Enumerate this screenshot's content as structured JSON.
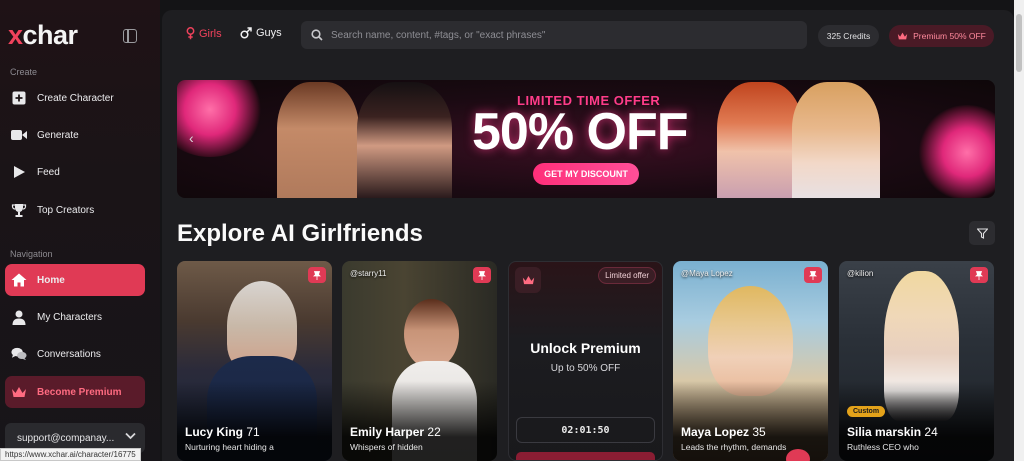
{
  "app": {
    "logo_x": "x",
    "logo_rest": "char"
  },
  "sidebar": {
    "create_label": "Create",
    "create_items": [
      {
        "label": "Create Character",
        "icon": "plus-square-icon"
      },
      {
        "label": "Generate",
        "icon": "video-camera-icon"
      },
      {
        "label": "Feed",
        "icon": "play-icon"
      },
      {
        "label": "Top Creators",
        "icon": "trophy-icon"
      }
    ],
    "navigation_label": "Navigation",
    "nav_items": [
      {
        "label": "Home",
        "icon": "home-icon",
        "active": true
      },
      {
        "label": "My Characters",
        "icon": "user-icon"
      },
      {
        "label": "Conversations",
        "icon": "chat-bubbles-icon"
      },
      {
        "label": "Become Premium",
        "icon": "crown-icon"
      }
    ],
    "support_email": "support@companay..."
  },
  "header": {
    "girls_label": "Girls",
    "guys_label": "Guys",
    "search_placeholder": "Search name, content, #tags, or \"exact phrases\"",
    "credits": "325 Credits",
    "premium_label": "Premium 50% OFF"
  },
  "banner": {
    "small_text": "LIMITED TIME OFFER",
    "big_text": "50% OFF",
    "cta": "GET MY DISCOUNT"
  },
  "section": {
    "title": "Explore AI Girlfriends"
  },
  "cards": [
    {
      "handle": "",
      "name": "Lucy King",
      "age": "71",
      "desc": "Nurturing heart hiding a"
    },
    {
      "handle": "@starry11",
      "name": "Emily Harper",
      "age": "22",
      "desc": "Whispers of hidden"
    },
    {
      "limited": "Limited offer",
      "title": "Unlock Premium",
      "subtitle": "Up to 50% OFF",
      "timer": "02:01:50"
    },
    {
      "handle": "@Maya Lopez",
      "name": "Maya Lopez",
      "age": "35",
      "desc": "Leads the rhythm, demands"
    },
    {
      "handle": "@kilion",
      "name": "Silia marskin",
      "age": "24",
      "desc": "Ruthless CEO who",
      "tag": "Custom"
    }
  ],
  "status_url": "https://www.xchar.ai/character/16775",
  "colors": {
    "accent": "#e03a55",
    "brand_pink": "#f0425c",
    "background": "#1e1e21"
  }
}
